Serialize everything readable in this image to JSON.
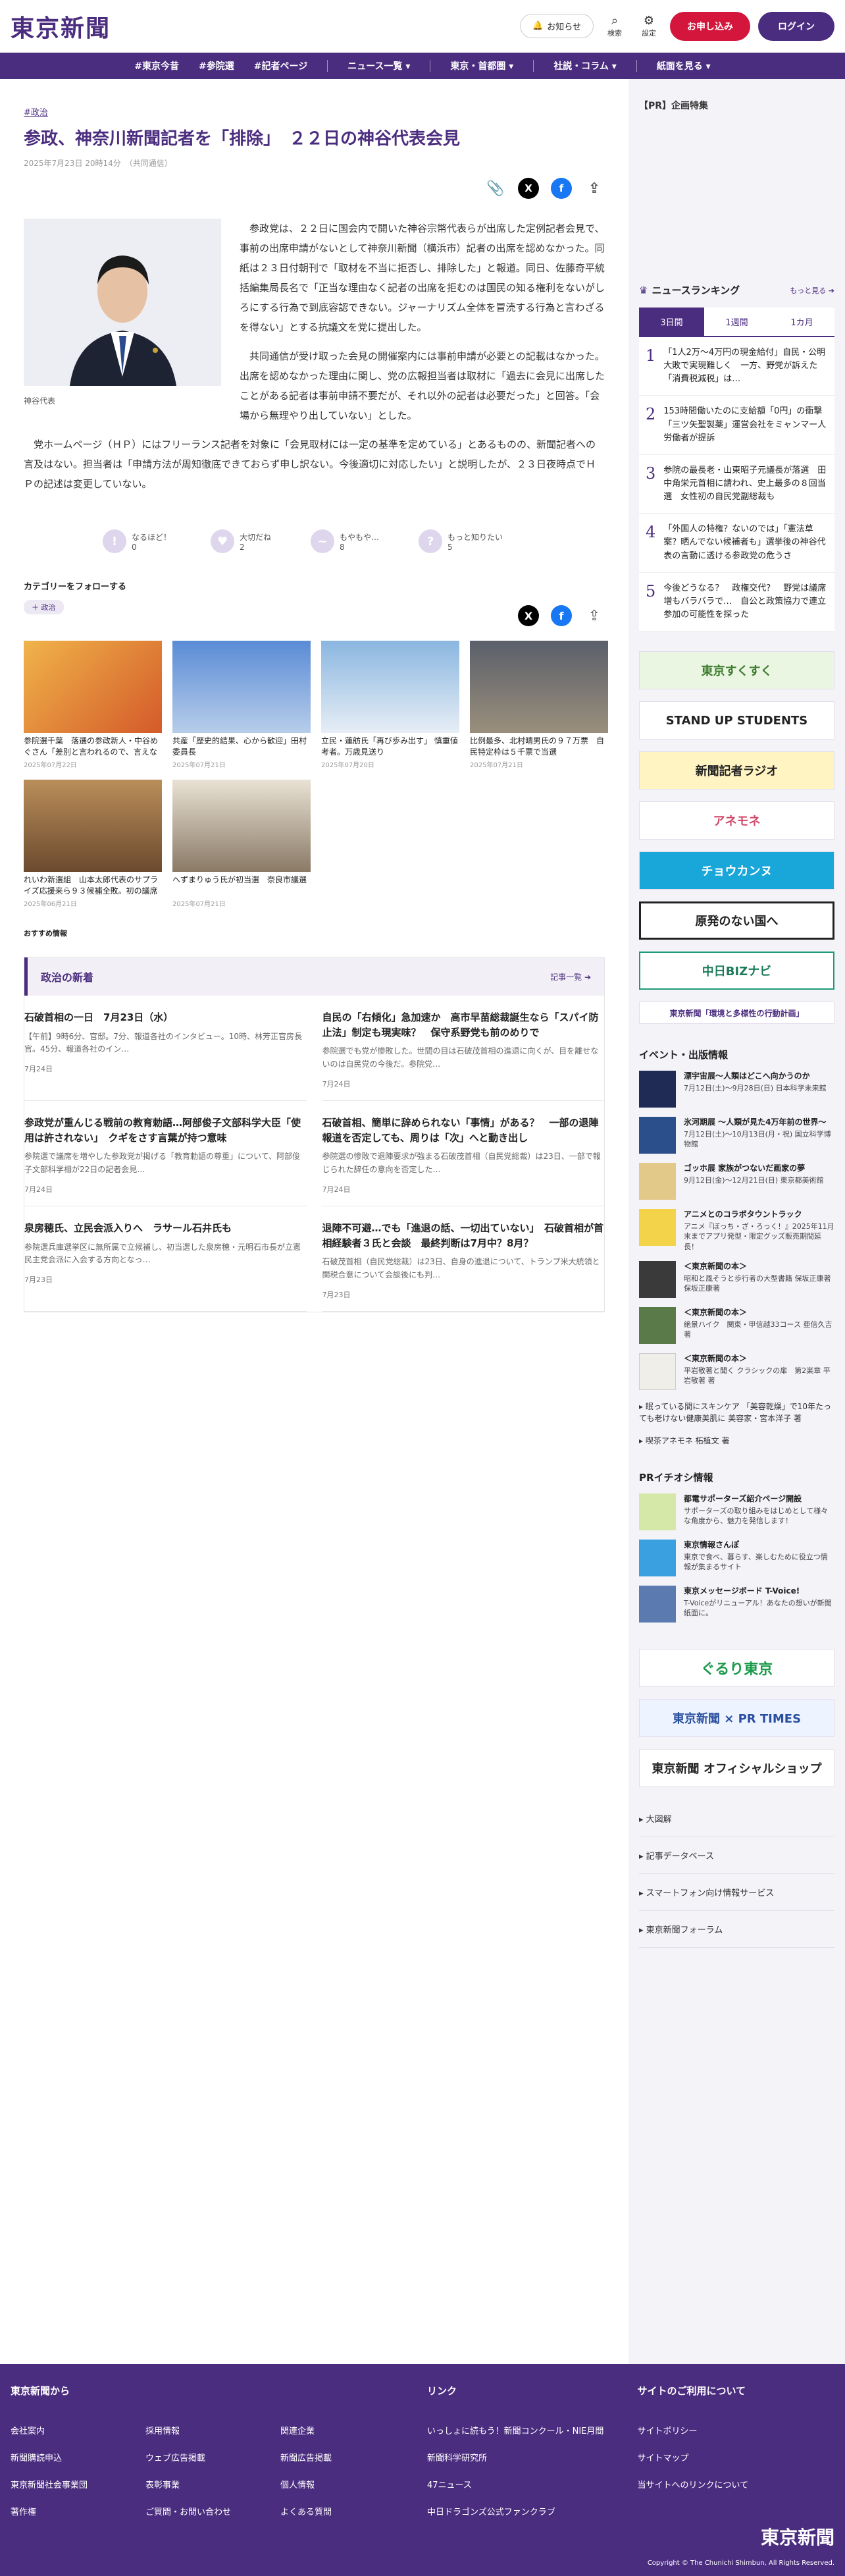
{
  "header": {
    "logo": "東京新聞",
    "notice": "お知らせ",
    "search": "検索",
    "settings": "設定",
    "apply": "お申し込み",
    "login": "ログイン"
  },
  "nav": [
    "#東京今昔",
    "#参院選",
    "#記者ページ",
    "ニュース一覧 ▾",
    "東京・首都圏 ▾",
    "社説・コラム ▾",
    "紙面を見る ▾"
  ],
  "article": {
    "tag": "#政治",
    "title": "参政、神奈川新聞記者を「排除」　２２日の神谷代表会見",
    "date": "2025年7月23日 20時14分　（共同通信）",
    "caption": "神谷代表",
    "paragraphs": [
      "参政党は、２２日に国会内で開いた神谷宗幣代表らが出席した定例記者会見で、事前の出席申請がないとして神奈川新聞（横浜市）記者の出席を認めなかった。同紙は２３日付朝刊で「取材を不当に拒否し、排除した」と報道。同日、佐藤奇平統括編集局長名で「正当な理由なく記者の出席を拒むのは国民の知る権利をないがしろにする行為で到底容認できない。ジャーナリズム全体を冒涜する行為と言わざるを得ない」とする抗議文を党に提出した。",
      "共同通信が受け取った会見の開催案内には事前申請が必要との記載はなかった。出席を認めなかった理由に関し、党の広報担当者は取材に「過去に会見に出席したことがある記者は事前申請不要だが、それ以外の記者は必要だった」と回答。「会場から無理やり出していない」とした。",
      "党ホームページ（ＨＰ）にはフリーランス記者を対象に「会見取材には一定の基準を定めている」とあるものの、新聞記者への言及はない。担当者は「申請方法が周知徹底できておらず申し訳ない。今後適切に対応したい」と説明したが、２３日夜時点でＨＰの記述は変更していない。"
    ]
  },
  "reactions": [
    {
      "label": "なるほど！",
      "count": "0"
    },
    {
      "label": "大切だね",
      "count": "2"
    },
    {
      "label": "もやもや…",
      "count": "8"
    },
    {
      "label": "もっと知りたい",
      "count": "5"
    }
  ],
  "follow": {
    "heading": "カテゴリーをフォローする",
    "chip": "＋ 政治"
  },
  "related": [
    {
      "title": "参院選千葉　落選の参政新人・中谷めぐさん「差別と言われるので、言えなかった」選挙活…",
      "date": "2025年07月22日"
    },
    {
      "title": "共産「歴史的結果、心から歓迎」田村委員長",
      "date": "2025年07月21日"
    },
    {
      "title": "立民・蓮舫氏「再び歩み出す」 慎重値考者。万歳見送り",
      "date": "2025年07月20日"
    },
    {
      "title": "比例最多、北村晴男氏の９７万票　自民特定枠は５千票で当選",
      "date": "2025年07月21日"
    },
    {
      "title": "れいわ新選組　山本太郎代表のサプライズ応援来ら９３候補全敗。初の議席獲得ならず　東…",
      "date": "2025年06月21日"
    },
    {
      "title": "へずまりゅう氏が初当選　奈良市議選",
      "date": "2025年07月21日"
    }
  ],
  "reco": "おすすめ情報",
  "politics": {
    "heading": "政治の新着",
    "more": "記事一覧",
    "items": [
      {
        "title": "石破首相の一日　7月23日（水）",
        "summary": "【午前】9時6分、官邸。7分、報道各社のインタビュー。10時、林芳正官房長官。45分、報道各社のイン…",
        "date": "7月24日"
      },
      {
        "title": "自民の「右傾化」急加速か　高市早苗総裁誕生なら「スパイ防止法」制定も現実味？　保守系野党も前のめりで",
        "summary": "参院選でも党が惨敗した。世間の目は石破茂首相の進退に向くが、目を離せないのは自民党の今後だ。参院党…",
        "date": "7月24日"
      },
      {
        "title": "参政党が重んじる戦前の教育勅語…阿部俊子文部科学大臣「使用は許されない」　クギをさす言葉が持つ意味",
        "summary": "参院選で議席を増やした参政党が掲げる「教育勅語の尊重」について、阿部俊子文部科学相が22日の記者会見…",
        "date": "7月24日"
      },
      {
        "title": "石破首相、簡単に辞められない「事情」がある？　一部の退陣報道を否定しても、周りは「次」へと動き出し",
        "summary": "参院選の惨敗で退陣要求が強まる石破茂首相（自民党総裁）は23日、一部で報じられた辞任の意向を否定した…",
        "date": "7月24日"
      },
      {
        "title": "泉房穂氏、立民会派入りへ　ラサール石井氏も",
        "summary": "参院選兵庫選挙区に無所属で立候補し、初当選した泉房穂・元明石市長が立憲民主党会派に入会する方向となっ…",
        "date": "7月23日"
      },
      {
        "title": "退陣不可避…でも「進退の話、一切出ていない」　石破首相が首相経験者３氏と会談　最終判断は7月中？8月？",
        "summary": "石破茂首相（自民党総裁）は23日、自身の進退について、トランプ米大統領と関税合意について会談後にも判…",
        "date": "7月23日"
      }
    ]
  },
  "side": {
    "pr": "【PR】企画特集",
    "ranking": {
      "heading": "ニュースランキング",
      "more": "もっと見る",
      "tabs": [
        "3日間",
        "1週間",
        "1カ月"
      ],
      "items": [
        "「1人2万〜4万円の現金給付」自民・公明大敗で実現難しく　一方、野党が訴えた「消費税減税」は…",
        "153時間働いたのに支給額「0円」の衝撃「三ツ矢聖製薬」運営会社をミャンマー人労働者が提訴",
        "参院の最長老・山東昭子元議長が落選　田中角栄元首相に請われ、史上最多の８回当選　女性初の自民党副総裁も",
        "「外国人の特権？ないのでは」「憲法草案？晒んでない候補者も」選挙後の神谷代表の言動に透ける参政党の危うさ",
        "今後どうなる？　政権交代？　野党は議席増もバラバラで…　自公と政策協力で連立参加の可能性を探った"
      ]
    },
    "banners": [
      "東京すくすく",
      "STAND UP STUDENTS",
      "新聞記者ラジオ",
      "アネモネ",
      "チョウカンヌ",
      "原発のない国へ",
      "中日BIZナビ",
      "東京新聞「環境と多様性の行動計画」"
    ],
    "events_heading": "イベント・出版情報",
    "events": [
      {
        "title": "漂宇宙展〜人類はどこへ向かうのか",
        "sub": "7月12日(土)〜9月28日(日) 日本科学未来館"
      },
      {
        "title": "氷河期展 〜人類が見た4万年前の世界〜",
        "sub": "7月12日(土)〜10月13日(月・祝) 国立科学博物館"
      },
      {
        "title": "ゴッホ展 家族がつないだ画家の夢",
        "sub": "9月12日(金)〜12月21日(日) 東京都美術館"
      },
      {
        "title": "アニメとのコラボタウントラック",
        "sub": "アニメ『ぼっち・ざ・ろっく！』2025年11月末までアプリ発型・限定グッズ販売期間延長！"
      },
      {
        "title": "＜東京新聞の本＞",
        "sub": "昭和と風そうと歩行者の大型書籍 保坂正康著 保坂正康著"
      },
      {
        "title": "＜東京新聞の本＞",
        "sub": "絶景ハイク　関東・甲信越33コース 亜信久吉 著"
      },
      {
        "title": "＜東京新聞の本＞",
        "sub": "平岩敬著と聞く クラシックの扉　第2楽章 平岩敬著 著"
      }
    ],
    "plinks": [
      "眠っている間にスキンケア 「美容乾燥」で10年たっても老けない健康美肌に 美容家・宮本洋子 著",
      "喫茶アネモネ 柘植文 著"
    ],
    "pr_heading": "PRイチオシ情報",
    "pr_items": [
      {
        "title": "都電サポーターズ紹介ページ開設",
        "sub": "サポーターズの取り組みをはじめとして様々な角度から、魅力を発信します！"
      },
      {
        "title": "東京情報さんぽ",
        "sub": "東京で食べ、暮らす、楽しむために役立つ情報が集まるサイト"
      },
      {
        "title": "東京メッセージボード T-Voice!",
        "sub": "T-Voiceがリニューアル！あなたの想いが新聞紙面に。"
      }
    ],
    "banners2": [
      "ぐるり東京",
      "東京新聞 × PR TIMES",
      "東京新聞 オフィシャルショップ"
    ],
    "links": [
      "大図解",
      "記事データベース",
      "スマートフォン向け情報サービス",
      "東京新聞フォーラム"
    ]
  },
  "footer": {
    "col1": "東京新聞から",
    "col1_links": [
      "会社案内",
      "採用情報",
      "関連企業",
      "新聞購読申込",
      "ウェブ広告掲載",
      "新聞広告掲載",
      "東京新聞社会事業団",
      "表彰事業",
      "個人情報",
      "著作権",
      "ご質問・お問い合わせ",
      "よくある質問"
    ],
    "col2": "リンク",
    "col2_links": [
      "いっしょに読もう！新聞コンクール・NIE月間",
      "新聞科学研究所",
      "47ニュース",
      "中日ドラゴンズ公式ファンクラブ"
    ],
    "col3": "サイトのご利用について",
    "col3_links": [
      "サイトポリシー",
      "サイトマップ",
      "当サイトへのリンクについて"
    ],
    "logo": "東京新聞",
    "copyright": "Copyright © The Chunichi Shimbun, All Rights Reserved."
  }
}
